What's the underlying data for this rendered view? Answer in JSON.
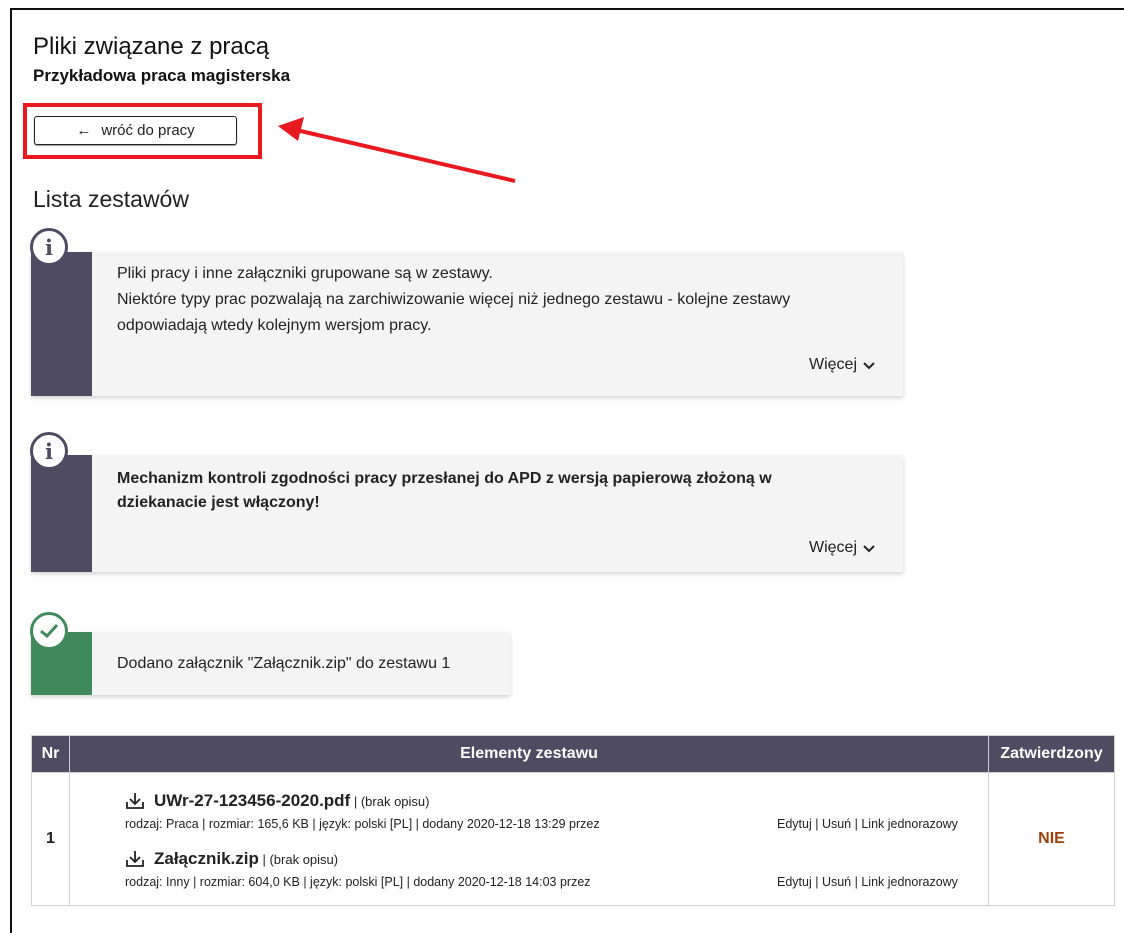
{
  "header": {
    "title": "Pliki związane z pracą",
    "subtitle": "Przykładowa praca magisterska"
  },
  "back_button": {
    "arrow": "←",
    "label": "wróć do pracy"
  },
  "section_title": "Lista zestawów",
  "notes": [
    {
      "type": "info",
      "icon": "info-icon",
      "glyph": "i",
      "lines": [
        "Pliki pracy i inne załączniki grupowane są w zestawy.",
        "Niektóre typy prac pozwalają na zarchiwizowanie więcej niż jednego zestawu - kolejne zestawy",
        "odpowiadają wtedy kolejnym wersjom pracy."
      ],
      "more": "Więcej"
    },
    {
      "type": "info",
      "icon": "info-icon",
      "glyph": "i",
      "lines": [
        "Mechanizm kontroli zgodności pracy przesłanej do APD z wersją papierową złożoną w",
        "dziekanacie jest włączony!"
      ],
      "more": "Więcej"
    },
    {
      "type": "success",
      "icon": "check-icon",
      "lines": [
        "Dodano załącznik \"Załącznik.zip\" do zestawu 1"
      ]
    }
  ],
  "table": {
    "headers": {
      "nr": "Nr",
      "items": "Elementy zestawu",
      "status": "Zatwierdzony"
    },
    "rows": [
      {
        "nr": "1",
        "status": "NIE",
        "files": [
          {
            "name": "UWr-27-123456-2020.pdf",
            "desc": " | (brak opisu)",
            "meta": "rodzaj: Praca | rozmiar: 165,6 KB | język: polski [PL] | dodany 2020-12-18 13:29 przez",
            "actions": {
              "edit": "Edytuj",
              "delete": "Usuń",
              "link": "Link jednorazowy",
              "sep": " | "
            }
          },
          {
            "name": "Załącznik.zip",
            "desc": " | (brak opisu)",
            "meta": "rodzaj: Inny | rozmiar: 604,0 KB | język: polski [PL] | dodany 2020-12-18 14:03 przez",
            "actions": {
              "edit": "Edytuj",
              "delete": "Usuń",
              "link": "Link jednorazowy",
              "sep": " | "
            }
          }
        ]
      }
    ]
  },
  "colors": {
    "info_bar": "#4e4b63",
    "success_bar": "#3f8a5b",
    "highlight": "#e8191f",
    "status_no": "#a0410d",
    "table_header": "#4e4b63"
  }
}
